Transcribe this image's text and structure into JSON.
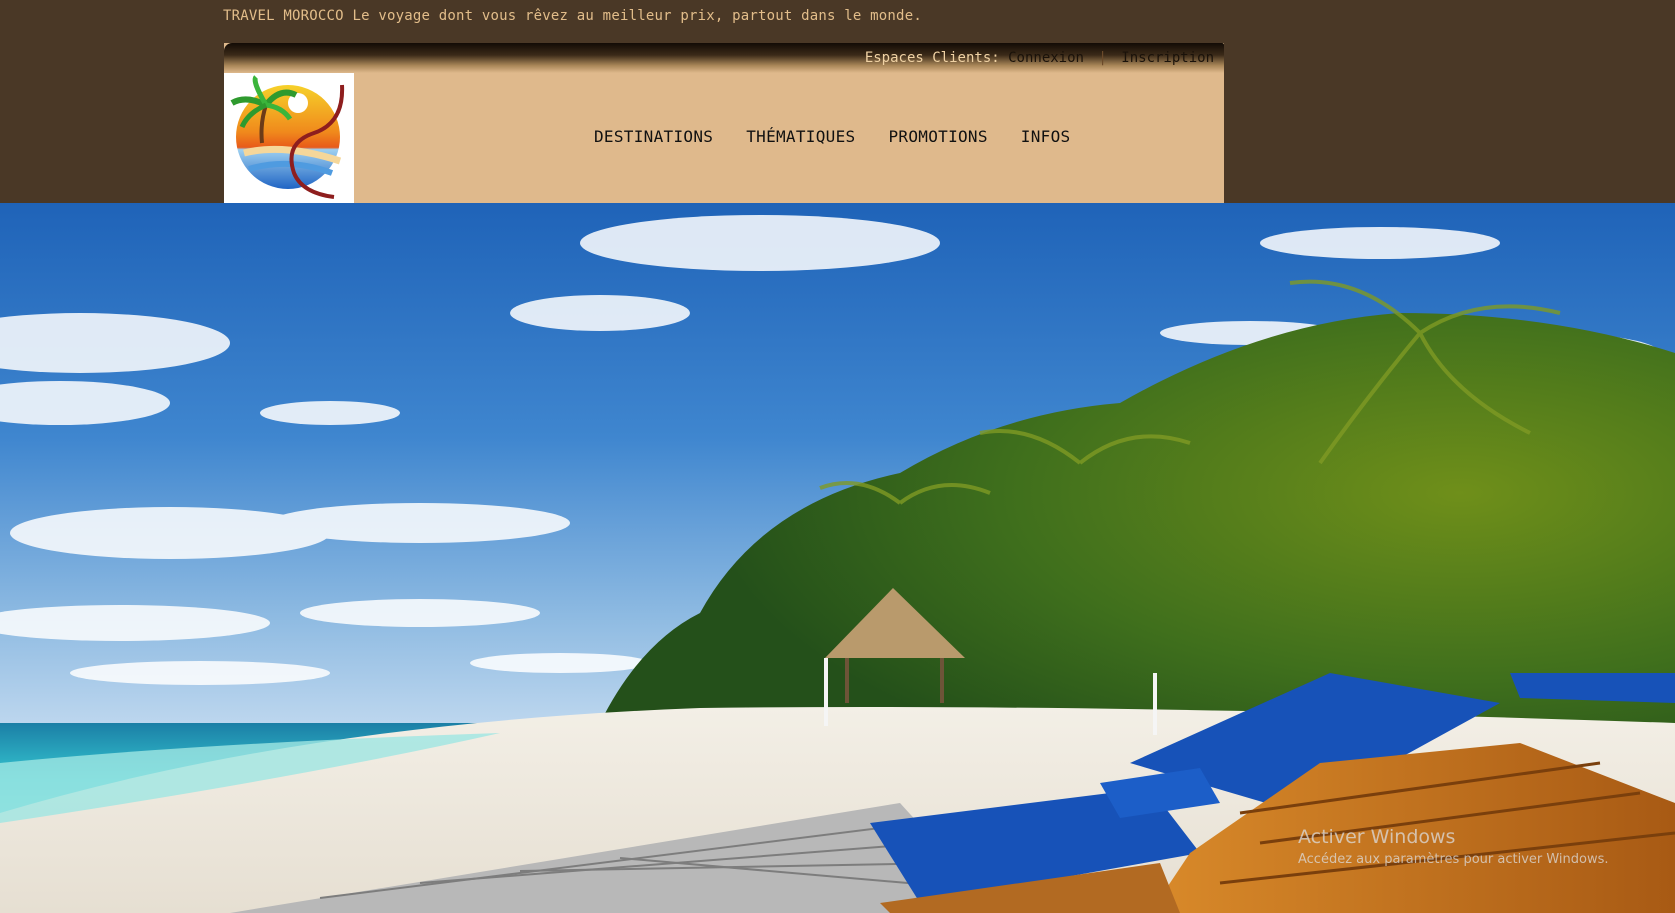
{
  "site": {
    "brand": "TRAVEL MOROCCO",
    "tagline": "Le voyage dont vous rêvez au meilleur prix, partout dans le monde."
  },
  "client_area": {
    "label": "Espaces Clients:",
    "login": "Connexion",
    "separator": "|",
    "register": "Inscription"
  },
  "nav": {
    "items": [
      {
        "label": "DESTINATIONS"
      },
      {
        "label": "THÉMATIQUES"
      },
      {
        "label": "PROMOTIONS"
      },
      {
        "label": "INFOS"
      }
    ]
  },
  "hero": {
    "scene": "tropical-beach-photo"
  },
  "os_watermark": {
    "title": "Activer Windows",
    "subtitle": "Accédez aux paramètres pour activer Windows."
  },
  "colors": {
    "page_background": "#4a3826",
    "header_background": "#dfb98c",
    "tagline_text": "#e2bd8a"
  }
}
